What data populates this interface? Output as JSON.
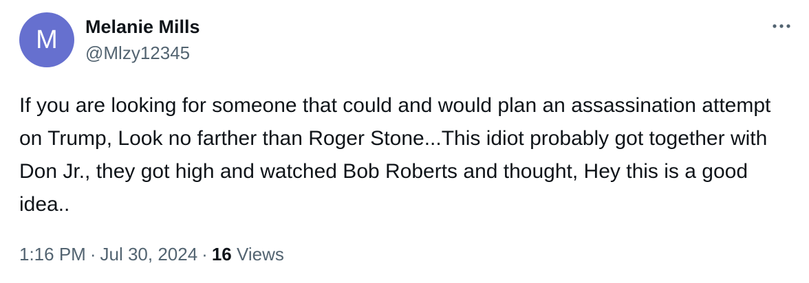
{
  "author": {
    "avatar_initial": "M",
    "avatar_color": "#6670cf",
    "display_name": "Melanie Mills",
    "handle": "@Mlzy12345"
  },
  "more_menu": {
    "icon": "more-horizontal-icon"
  },
  "tweet": {
    "text": "If you are looking for someone that could and would plan an assassination attempt on Trump, Look no farther than Roger Stone...This idiot probably got together with Don Jr., they got high and watched Bob Roberts and thought, Hey this is a good idea.."
  },
  "meta": {
    "time": "1:16 PM",
    "separator": "·",
    "date": "Jul 30, 2024",
    "views_count": "16",
    "views_label": "Views"
  }
}
